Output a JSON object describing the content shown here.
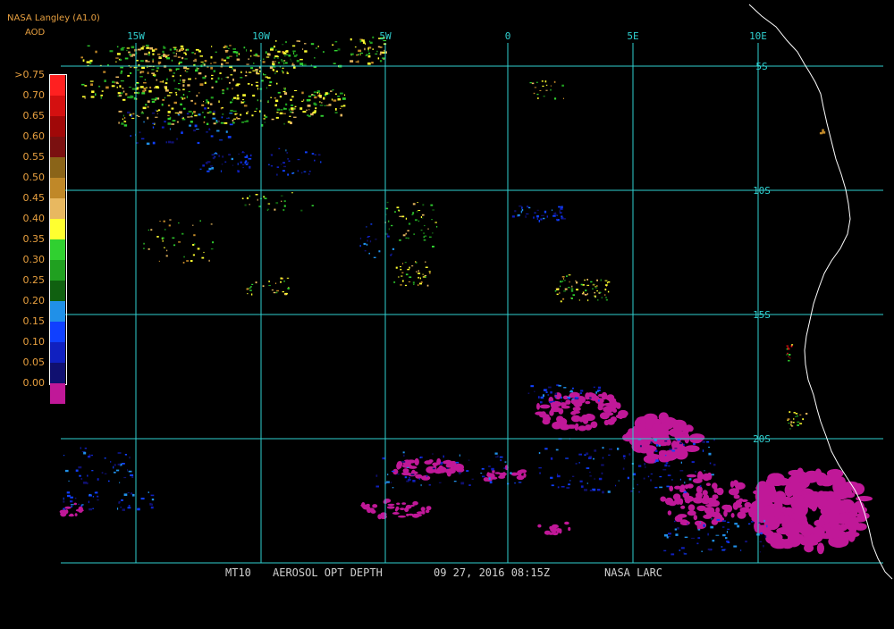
{
  "header": {
    "source": "NASA Langley (A1.0)",
    "product": "AOD"
  },
  "legend": {
    "entries": [
      {
        "label": ">0.75",
        "color": "#ff2020"
      },
      {
        "label": "0.70",
        "color": "#d41010"
      },
      {
        "label": "0.65",
        "color": "#a00808"
      },
      {
        "label": "0.60",
        "color": "#7a1010"
      },
      {
        "label": "0.55",
        "color": "#8a6418"
      },
      {
        "label": "0.50",
        "color": "#c08828"
      },
      {
        "label": "0.45",
        "color": "#e8b860"
      },
      {
        "label": "0.40",
        "color": "#ffff30"
      },
      {
        "label": "0.35",
        "color": "#30d030"
      },
      {
        "label": "0.30",
        "color": "#20a020"
      },
      {
        "label": "0.25",
        "color": "#106010"
      },
      {
        "label": "0.20",
        "color": "#2090e8"
      },
      {
        "label": "0.15",
        "color": "#1040ff"
      },
      {
        "label": "0.10",
        "color": "#1020c0"
      },
      {
        "label": "0.05",
        "color": "#101070"
      },
      {
        "label": "0.00",
        "color": "#c01898"
      }
    ]
  },
  "map": {
    "lon_labels": [
      "15W",
      "10W",
      "5W",
      "0",
      "5E",
      "10E"
    ],
    "lat_labels": [
      "5S",
      "10S",
      "15S",
      "20S"
    ],
    "grid_color": "#30d0d0",
    "coast_color": "#ffffff",
    "label_color": "#30d0d0"
  },
  "footer": {
    "product": "MT10",
    "title": "AEROSOL OPT DEPTH",
    "datetime": "09 27, 2016 08:15Z",
    "source": "NASA LARC"
  }
}
